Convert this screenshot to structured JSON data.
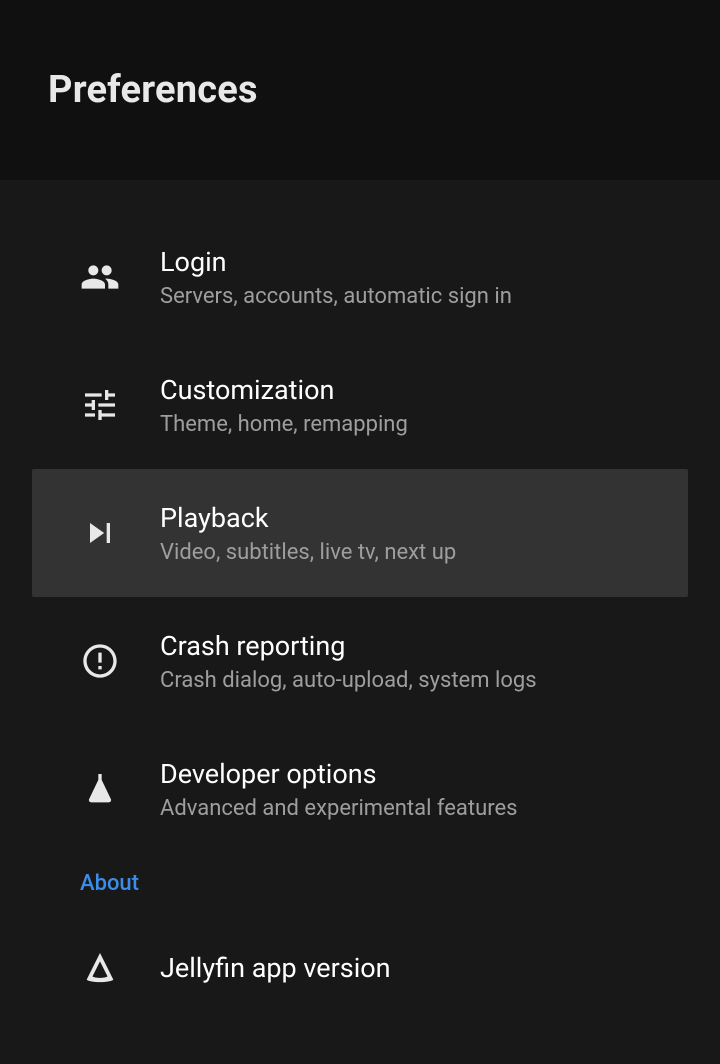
{
  "header": {
    "title": "Preferences"
  },
  "items": [
    {
      "title": "Login",
      "subtitle": "Servers, accounts, automatic sign in"
    },
    {
      "title": "Customization",
      "subtitle": "Theme, home, remapping"
    },
    {
      "title": "Playback",
      "subtitle": "Video, subtitles, live tv, next up"
    },
    {
      "title": "Crash reporting",
      "subtitle": "Crash dialog, auto-upload, system logs"
    },
    {
      "title": "Developer options",
      "subtitle": "Advanced and experimental features"
    }
  ],
  "section": {
    "about": "About"
  },
  "about_items": [
    {
      "title": "Jellyfin app version"
    }
  ],
  "selected_index": 2
}
